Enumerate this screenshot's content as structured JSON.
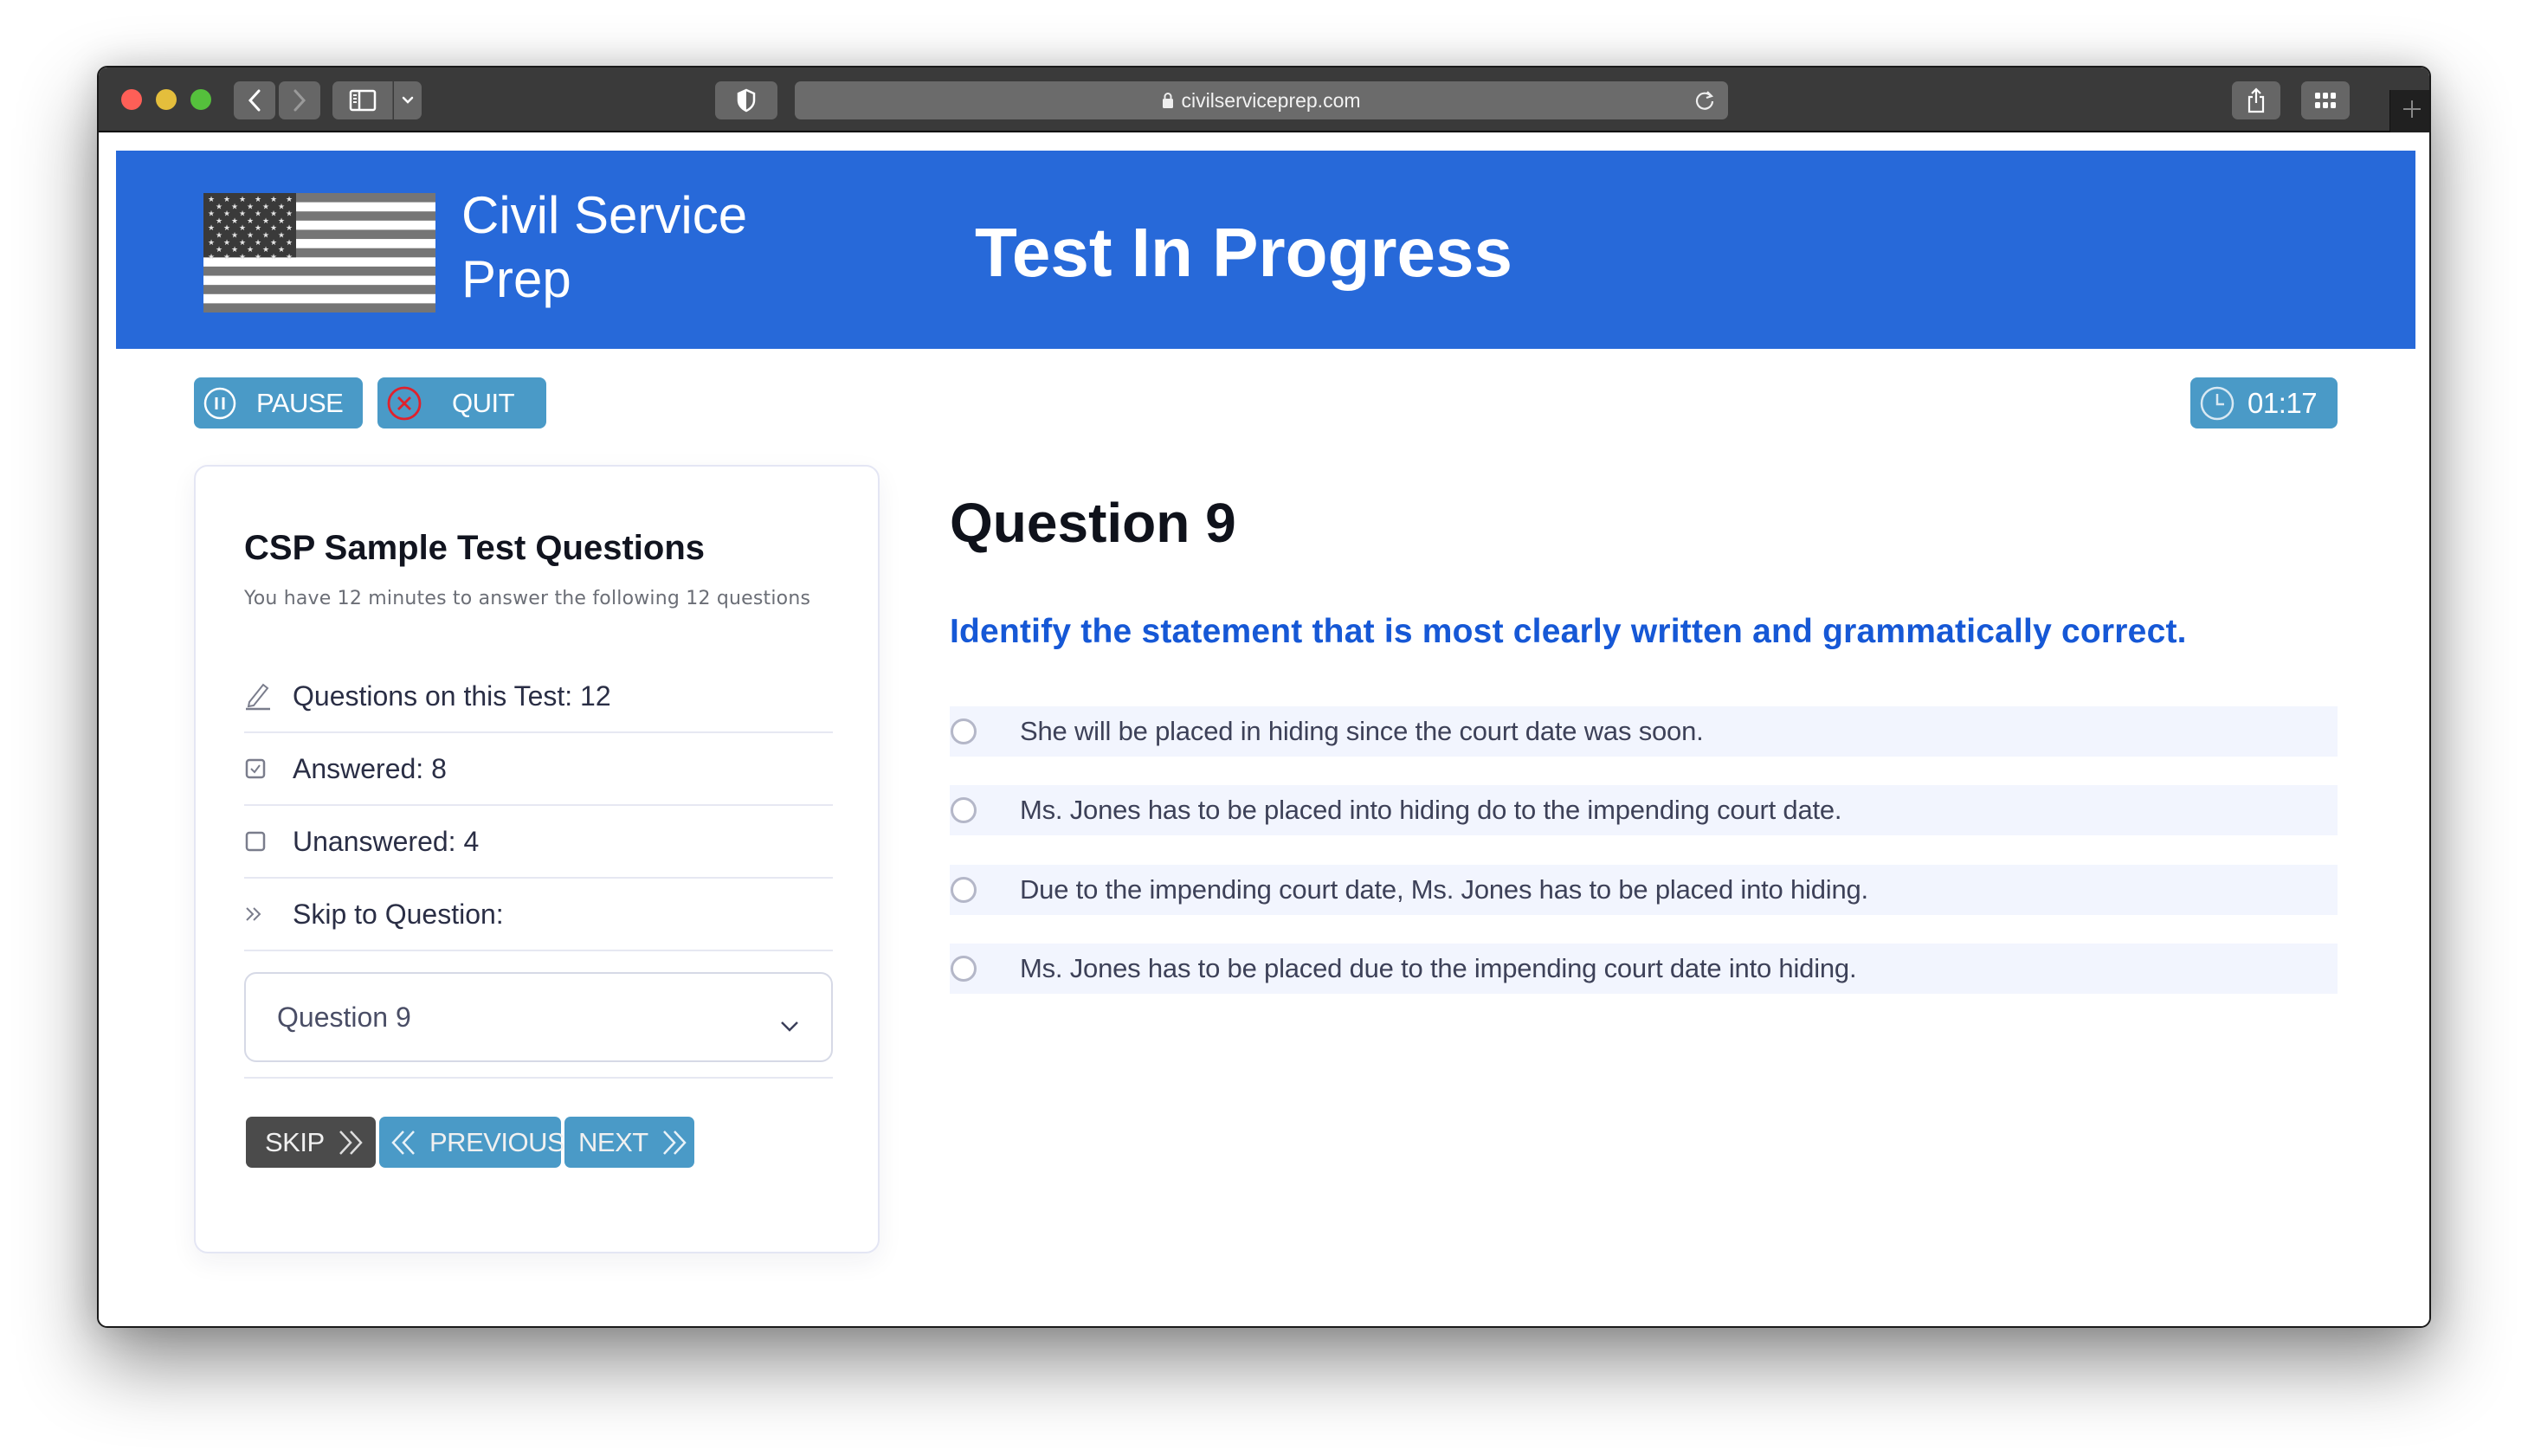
{
  "browser": {
    "url": "civilserviceprep.com",
    "icons": {
      "back": "chevron-left-icon",
      "forward": "chevron-right-icon",
      "sidebar": "sidebar-icon",
      "sidebar_dropdown": "chevron-down-icon",
      "privacy": "shield-icon",
      "lock": "lock-icon",
      "reload": "reload-icon",
      "share": "share-icon",
      "tabs": "grid-icon",
      "new_tab": "plus-icon"
    }
  },
  "header": {
    "brand_line1": "Civil Service",
    "brand_line2": "Prep",
    "title": "Test In Progress",
    "logo": "us-flag-grayscale",
    "background_color": "#2769d9"
  },
  "toolbar": {
    "pause_label": "PAUSE",
    "quit_label": "QUIT",
    "timer": "01:17",
    "button_color": "#4a9ac7",
    "quit_icon_color": "#e0212c"
  },
  "sidebar": {
    "title": "CSP Sample Test Questions",
    "subtitle": "You have 12 minutes to answer the following 12 questions",
    "stats": [
      {
        "icon": "pencil-icon",
        "label": "Questions on this Test: 12"
      },
      {
        "icon": "checked-box-icon",
        "label": "Answered: 8"
      },
      {
        "icon": "empty-box-icon",
        "label": "Unanswered: 4"
      },
      {
        "icon": "double-chevron-right-icon",
        "label": "Skip to Question:"
      }
    ],
    "skip_select": {
      "selected": "Question 9"
    },
    "buttons": {
      "skip": "SKIP",
      "previous": "PREVIOUS",
      "next": "NEXT"
    }
  },
  "question": {
    "title": "Question 9",
    "prompt": "Identify the statement that is most clearly written and grammatically correct.",
    "prompt_color": "#1658d6",
    "options": [
      "She will be placed in hiding since the court date was soon.",
      "Ms. Jones has to be placed into hiding do to the impending court date.",
      "Due to the impending court date, Ms. Jones has to be placed into hiding.",
      "Ms. Jones has to be placed due to the impending court date into hiding."
    ]
  }
}
